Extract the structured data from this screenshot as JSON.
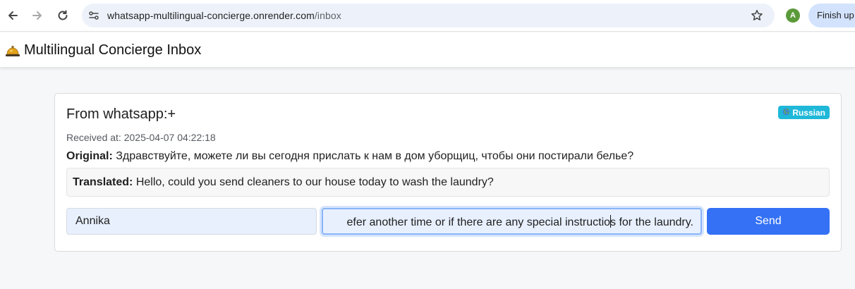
{
  "browser": {
    "url_host": "whatsapp-multilingual-concierge.onrender.com",
    "url_path": "/inbox",
    "profile_initial": "A",
    "finish_label": "Finish up",
    "nav_icons": [
      "back-arrow-icon",
      "forward-arrow-icon",
      "reload-icon"
    ],
    "colors": {
      "omnibox_bg": "#edf2fa",
      "profile_bg": "#5b9a3a",
      "finish_bg": "#d3e3fd"
    }
  },
  "header": {
    "icon": "bell-icon",
    "title": "Multilingual Concierge Inbox"
  },
  "message": {
    "from": "From whatsapp:+",
    "language_badge": "Russian",
    "badge_icon": "globe-icon",
    "received_label": "Received at: 2025-04-07 04:22:18",
    "original_label": "Original:",
    "original_text": "Здравствуйте, можете ли вы сегодня прислать к нам в дом уборщиц, чтобы они постирали белье?",
    "translated_label": "Translated:",
    "translated_text": "Hello, could you send cleaners to our house today to wash the laundry?",
    "agent_name_value": "Annika",
    "reply_visible_before_caret": "efer another time or if there are any special instructio",
    "reply_visible_after_caret": "s for the laundry.",
    "send_label": "Send",
    "colors": {
      "badge": "#1fb8d9",
      "send_button": "#3471f5",
      "input_bg": "#e8f0fe"
    }
  }
}
